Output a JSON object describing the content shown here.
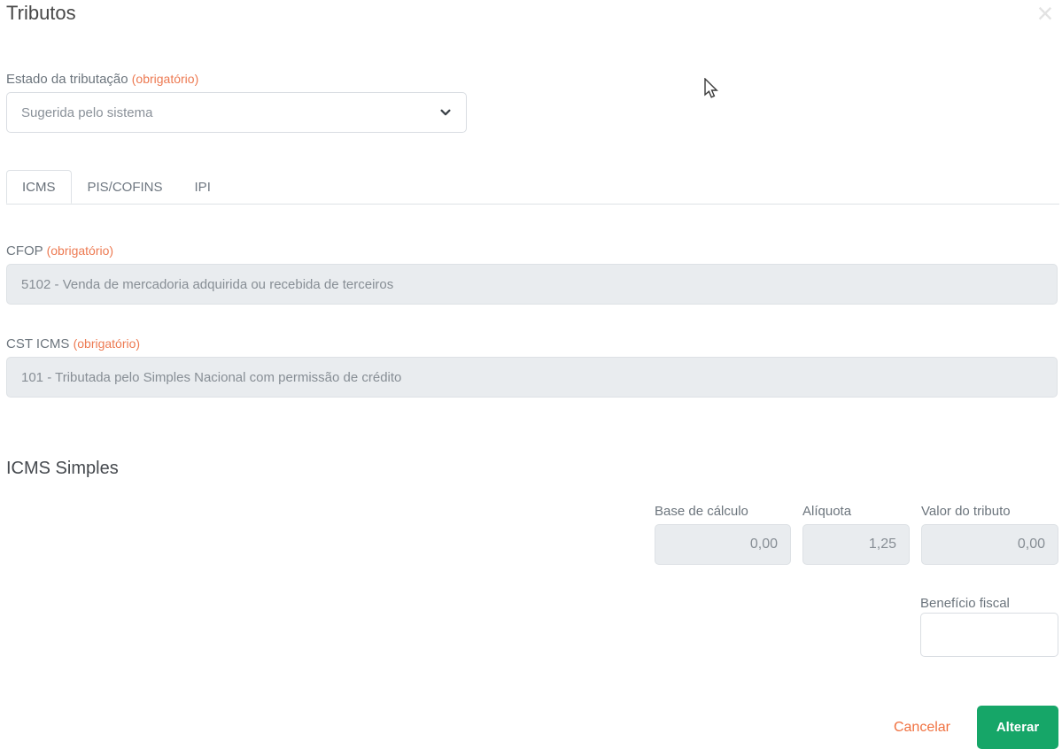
{
  "modal": {
    "title": "Tributos",
    "close_icon": "×"
  },
  "estado_tributacao": {
    "label": "Estado da tributação",
    "required": "(obrigatório)",
    "value": "Sugerida pelo sistema"
  },
  "tabs": [
    {
      "label": "ICMS",
      "active": true
    },
    {
      "label": "PIS/COFINS",
      "active": false
    },
    {
      "label": "IPI",
      "active": false
    }
  ],
  "cfop": {
    "label": "CFOP",
    "required": "(obrigatório)",
    "value": "5102 - Venda de mercadoria adquirida ou recebida de terceiros"
  },
  "cst_icms": {
    "label": "CST ICMS",
    "required": "(obrigatório)",
    "value": "101 - Tributada pelo Simples Nacional com permissão de crédito"
  },
  "icms_simples": {
    "heading": "ICMS Simples",
    "base_calculo": {
      "label": "Base de cálculo",
      "value": "0,00"
    },
    "aliquota": {
      "label": "Alíquota",
      "value": "1,25"
    },
    "valor_tributo": {
      "label": "Valor do tributo",
      "value": "0,00"
    },
    "beneficio_fiscal": {
      "label": "Benefício fiscal",
      "value": ""
    }
  },
  "footer": {
    "cancel_label": "Cancelar",
    "submit_label": "Alterar"
  },
  "colors": {
    "required_orange": "#ed7a52",
    "cancel_orange": "#f0703f",
    "success_green": "#16a668",
    "disabled_bg": "#e9ecef"
  }
}
